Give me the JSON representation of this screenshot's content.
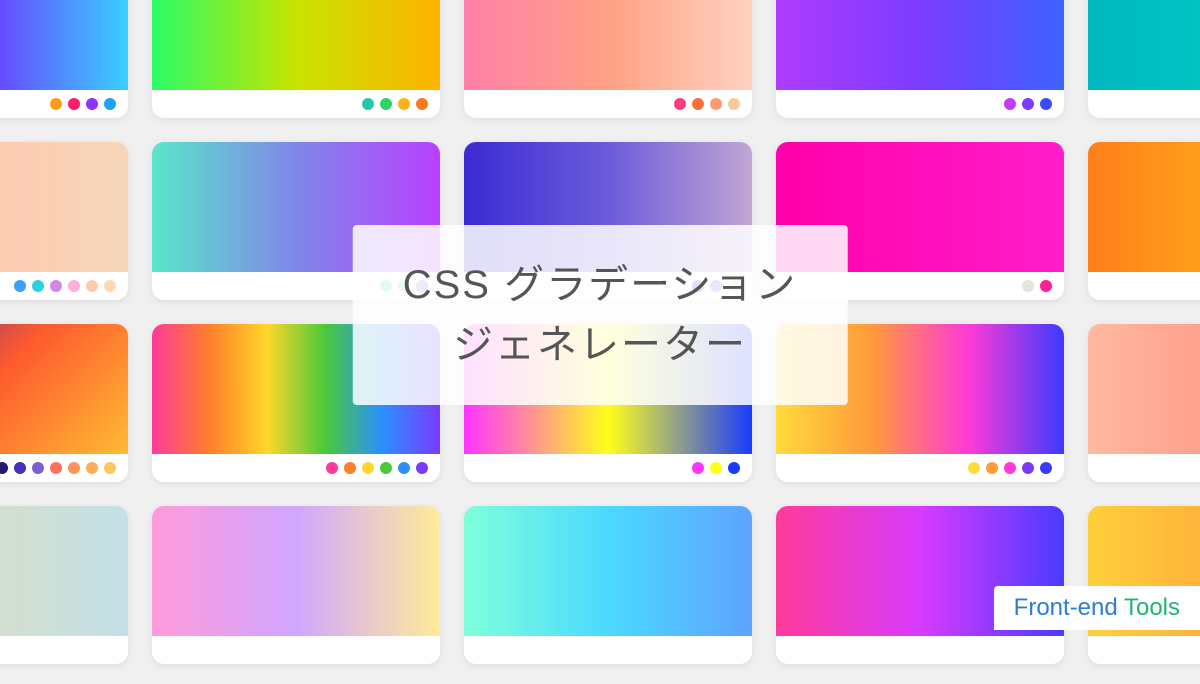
{
  "title": {
    "line1": "CSS グラデーション",
    "line2": "ジェネレーター"
  },
  "brand": {
    "part1": "Front-end ",
    "part2": "Tools"
  },
  "cards": [
    {
      "gradient": "linear-gradient(90deg,#ff1abf,#6a3cff,#3ad0ff)",
      "dots": [
        "#ff9c1a",
        "#ff1e66",
        "#9133ff",
        "#1ea0ff"
      ]
    },
    {
      "gradient": "linear-gradient(90deg,#2afc66,#c7e400,#ffb300)",
      "dots": [
        "#24c9a8",
        "#30d36a",
        "#ffb11a",
        "#ff7a1a"
      ]
    },
    {
      "gradient": "linear-gradient(90deg,#ff7fa8,#ffa184,#ffd2c0)",
      "dots": [
        "#ff3d7e",
        "#ff6f3d",
        "#ff9c6f",
        "#ffc69a"
      ]
    },
    {
      "gradient": "linear-gradient(90deg,#b03cff,#7a3cff,#3c62ff)",
      "dots": [
        "#c23cff",
        "#7a3cff",
        "#3c4aff"
      ]
    },
    {
      "gradient": "linear-gradient(90deg,#00b8bf,#00d6c8)",
      "dots": [
        "#00a6b0",
        "#00d6c8"
      ]
    },
    {
      "gradient": "linear-gradient(90deg,#ff8fd1,#ffcab2,#f5d7b8)",
      "dots": [
        "#3aa0ff",
        "#2bd1e0",
        "#d188e8",
        "#ffb0d9",
        "#ffcbb0",
        "#ffd9b3"
      ]
    },
    {
      "gradient": "linear-gradient(90deg,#5ae6c9,#7f87e8,#b940ff)",
      "dots": [
        "#45e0c0",
        "#6fd98e",
        "#9b6aff"
      ]
    },
    {
      "gradient": "linear-gradient(90deg,#3b2bd4,#6b5bd9,#c2a6d4)",
      "dots": [
        "#3b2bd4",
        "#7a55d6",
        "#f7c9a0"
      ]
    },
    {
      "gradient": "linear-gradient(90deg,#ff00aa,#ff1ec9)",
      "dots": [
        "#e8e3db",
        "#ff1e9a"
      ]
    },
    {
      "gradient": "linear-gradient(90deg,#ff7f1a,#ffcf1a)",
      "dots": [
        "#ff7f1a",
        "#ffcf1a"
      ]
    },
    {
      "gradient": "linear-gradient(135deg,#3b1fa8,#ff5a2e,#ffbb33)",
      "dots": [
        "#2a176b",
        "#4a2fb8",
        "#7a5fd1",
        "#ff725a",
        "#ff935a",
        "#ffad5a",
        "#ffc65a"
      ]
    },
    {
      "gradient": "linear-gradient(90deg,#ff3b9a,#ff7f2a,#ffd62a,#4ac93a,#2a8fff,#7a3bff)",
      "dots": [
        "#ff3b9a",
        "#ff7f2a",
        "#ffd62a",
        "#4ac93a",
        "#2a8fff",
        "#7a3bff"
      ]
    },
    {
      "gradient": "linear-gradient(90deg,#ff33ff,#ffff1a,#1a3bff)",
      "dots": [
        "#ff33ff",
        "#ffff1a",
        "#1a3bff"
      ]
    },
    {
      "gradient": "linear-gradient(90deg,#ffdb3b,#ff9a3b,#ff3bd6,#3b3bff)",
      "dots": [
        "#ffdb3b",
        "#ff9a3b",
        "#ff3bd6",
        "#7a3bff",
        "#3b3bff"
      ]
    },
    {
      "gradient": "linear-gradient(90deg,#ffb9a1,#ff7a6f)",
      "dots": [
        "#ffb9a1",
        "#ff7a6f"
      ]
    },
    {
      "gradient": "linear-gradient(90deg,#e8deb0,#c3e0e8)",
      "dots": []
    },
    {
      "gradient": "linear-gradient(90deg,#ff9ada,#d0a6ff,#ffeb99)",
      "dots": []
    },
    {
      "gradient": "linear-gradient(90deg,#7fffda,#4ad9ff,#5fa3ff)",
      "dots": []
    },
    {
      "gradient": "linear-gradient(90deg,#ff3b9a,#d83bff,#4a3bff)",
      "dots": []
    },
    {
      "gradient": "linear-gradient(90deg,#ffcf3b,#ff8a3b)",
      "dots": []
    }
  ]
}
